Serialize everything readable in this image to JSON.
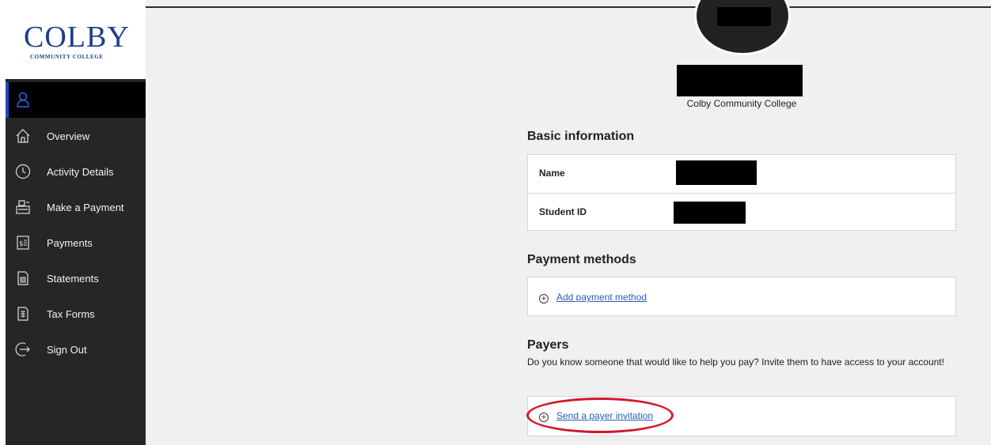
{
  "sidebar": {
    "logo": {
      "text": "COLBY",
      "subtitle": "COMMUNITY COLLEGE"
    },
    "user_icon": "user-icon",
    "items": [
      {
        "label": "Overview",
        "icon": "home-icon"
      },
      {
        "label": "Activity Details",
        "icon": "clock-icon"
      },
      {
        "label": "Make a Payment",
        "icon": "register-icon"
      },
      {
        "label": "Payments",
        "icon": "receipt-icon"
      },
      {
        "label": "Statements",
        "icon": "statement-icon"
      },
      {
        "label": "Tax Forms",
        "icon": "tax-form-icon"
      },
      {
        "label": "Sign Out",
        "icon": "sign-out-icon"
      }
    ]
  },
  "profile": {
    "org": "Colby Community College"
  },
  "basic_info": {
    "title": "Basic information",
    "name_label": "Name",
    "student_id_label": "Student ID"
  },
  "payment_methods": {
    "title": "Payment methods",
    "add_link": "Add payment method"
  },
  "payers": {
    "title": "Payers",
    "description": "Do you know someone that would like to help you pay? Invite them to have access to your account!",
    "invite_link": "Send a payer invitation"
  },
  "colors": {
    "accent": "#1d4bbd",
    "link": "#2a5bb8",
    "highlight": "#d0192a",
    "sidebar_bg": "#262626"
  }
}
